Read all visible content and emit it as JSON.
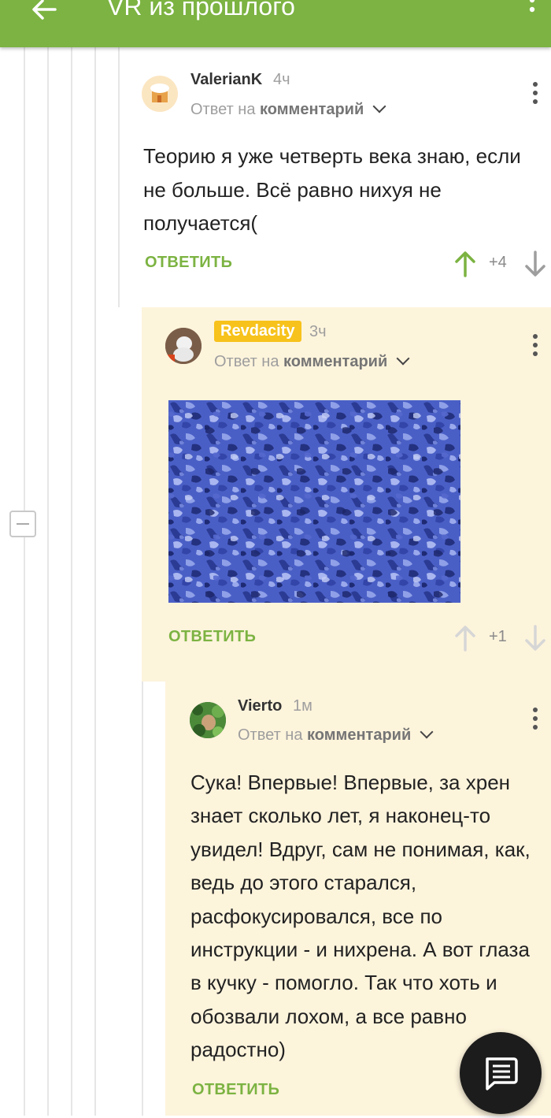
{
  "header": {
    "title": "VR из прошлого",
    "back_icon": "arrow-left-icon",
    "menu_icon": "more-vertical-icon",
    "bg_color": "#7cb342"
  },
  "comments": [
    {
      "username": "ValerianK",
      "time": "4ч",
      "reply_prefix": "Ответ на",
      "reply_link": "комментарий",
      "text": "Теорию я уже четверть века знаю, если не больше. Всё равно нихуя не получается(",
      "reply_label": "ОТВЕТИТЬ",
      "rating": "+4"
    },
    {
      "username": "Revdacity",
      "time": "3ч",
      "reply_prefix": "Ответ на",
      "reply_link": "комментарий",
      "image": "autostereogram-image",
      "reply_label": "ОТВЕТИТЬ",
      "rating": "+1"
    },
    {
      "username": "Vierto",
      "time": "1м",
      "reply_prefix": "Ответ на",
      "reply_link": "комментарий",
      "text": "Сука! Впервые! Впервые, за хрен знает сколько лет, я наконец-то увидел! Вдруг, сам не понимая, как, ведь до этого старался, расфокусировался, все по инструкции - и нихрена. А вот глаза в кучку - помогло. Так что хоть и обозвали лохом, а все равно радостно)",
      "reply_label": "ОТВЕТИТЬ"
    }
  ],
  "fab_icon": "comment-icon",
  "colors": {
    "accent": "#7cb342",
    "highlight": "#f7c21b",
    "panel": "#fdf4dc"
  }
}
